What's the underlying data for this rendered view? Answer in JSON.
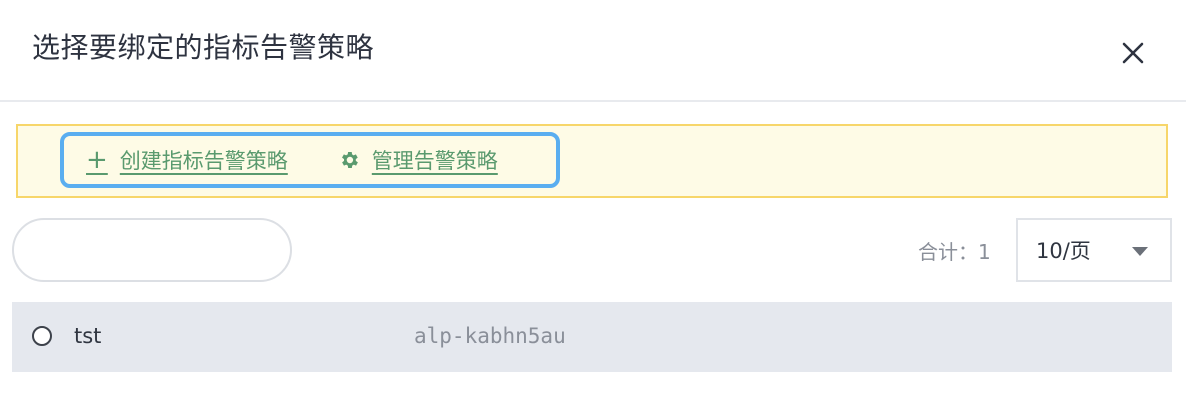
{
  "dialog": {
    "title": "选择要绑定的指标告警策略",
    "close_icon": "close-icon"
  },
  "notice": {
    "create_link": "创建指标告警策略",
    "create_icon": "plus-icon",
    "manage_link": "管理告警策略",
    "manage_icon": "gear-icon",
    "link_color": "#5a9a6e",
    "highlight_color": "#5aaef0"
  },
  "search": {
    "value": "",
    "placeholder": ""
  },
  "pagination": {
    "total_label": "合计：1",
    "page_size": "10/页"
  },
  "list": {
    "items": [
      {
        "name": "tst",
        "id": "alp-kabhn5au",
        "selected": false
      }
    ]
  }
}
